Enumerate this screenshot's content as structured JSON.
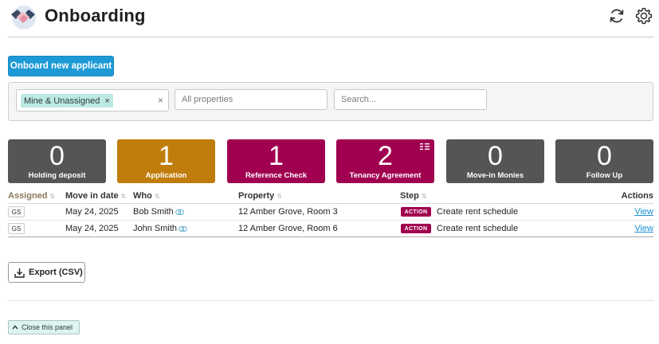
{
  "header": {
    "title": "Onboarding",
    "logo_icon": "handshake-icon",
    "refresh_icon": "refresh-icon",
    "settings_icon": "gear-icon"
  },
  "actions": {
    "onboard_label": "Onboard new applicant"
  },
  "filters": {
    "assigned_tag": "Mine & Unassigned",
    "tag_remove": "×",
    "clear": "×",
    "properties_placeholder": "All properties",
    "search_placeholder": "Search..."
  },
  "colors": {
    "primary": "#1d9ad6",
    "grey_card": "#555555",
    "application_card": "#c07d0b",
    "magenta_card": "#a0004f",
    "tag_bg": "#bde9e4"
  },
  "stages": [
    {
      "count": "0",
      "label": "Holding deposit",
      "color": "#555555"
    },
    {
      "count": "1",
      "label": "Application",
      "color": "#c07d0b"
    },
    {
      "count": "1",
      "label": "Reference Check",
      "color": "#a0004f"
    },
    {
      "count": "2",
      "label": "Tenancy Agreement",
      "color": "#a0004f"
    },
    {
      "count": "0",
      "label": "Move-in Monies",
      "color": "#555555"
    },
    {
      "count": "0",
      "label": "Follow Up",
      "color": "#555555"
    }
  ],
  "table": {
    "columns": {
      "assigned": "Assigned",
      "move_in": "Move in date",
      "who": "Who",
      "property": "Property",
      "step": "Step",
      "actions": "Actions"
    },
    "rows": [
      {
        "assigned": "GS",
        "move_in": "May 24, 2025",
        "who": "Bob Smith",
        "property": "12 Amber Grove, Room 3",
        "badge": "ACTION",
        "step": "Create rent schedule",
        "action": "View"
      },
      {
        "assigned": "GS",
        "move_in": "May 24, 2025",
        "who": "John Smith",
        "property": "12 Amber Grove, Room 6",
        "badge": "ACTION",
        "step": "Create rent schedule",
        "action": "View"
      }
    ]
  },
  "footer": {
    "export_label": "Export (CSV)",
    "close_label": "Close this panel"
  }
}
